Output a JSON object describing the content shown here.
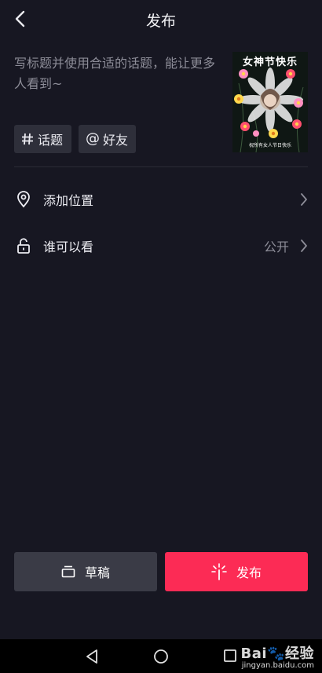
{
  "header": {
    "title": "发布"
  },
  "composer": {
    "placeholder": "写标题并使用合适的话题，能让更多人看到~"
  },
  "cover": {
    "top_text": "女神节快乐",
    "bottom_text": "祝所有女人节日快乐"
  },
  "chips": {
    "topic": "话题",
    "friend": "好友",
    "friend_prefix": "@"
  },
  "settings": {
    "location_label": "添加位置",
    "visibility_label": "谁可以看",
    "visibility_value": "公开"
  },
  "actions": {
    "draft": "草稿",
    "publish": "发布"
  },
  "colors": {
    "background": "#171722",
    "accent": "#fc2b55",
    "chip": "#2e2f3a",
    "draft_button": "#3a3b46"
  },
  "watermark": {
    "main": "Bai🐾经验",
    "sub": "jingyan.baidu.com"
  }
}
